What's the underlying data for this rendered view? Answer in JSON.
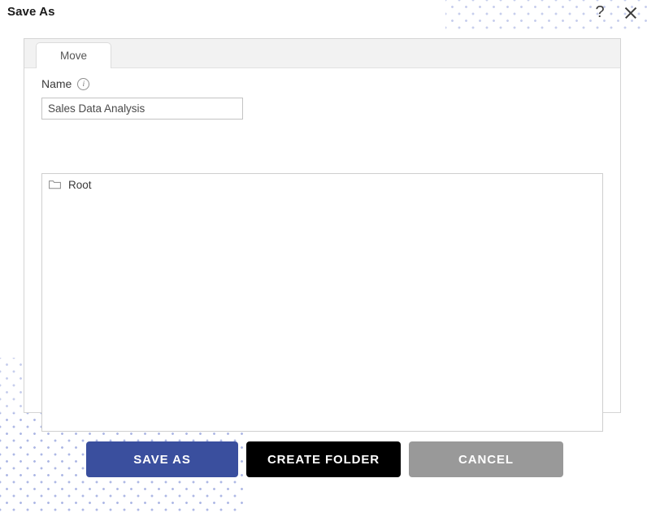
{
  "dialog": {
    "title": "Save As",
    "help_icon": "question-mark-icon",
    "close_icon": "close-icon"
  },
  "tabs": [
    {
      "label": "Move",
      "active": true
    }
  ],
  "form": {
    "name_label": "Name",
    "info_icon": "i",
    "name_value": "Sales Data Analysis",
    "name_placeholder": "Name"
  },
  "folder_tree": {
    "items": [
      {
        "label": "Root",
        "icon": "folder-icon"
      }
    ]
  },
  "buttons": {
    "save_as": "SAVE AS",
    "create_folder": "CREATE FOLDER",
    "cancel": "CANCEL"
  },
  "colors": {
    "save_as_bg": "#3a4f9e",
    "create_folder_bg": "#000000",
    "cancel_bg": "#999999",
    "dot_pattern": "#9aa7e0",
    "tab_strip_bg": "#f2f2f2",
    "panel_border": "#d4d4d4"
  }
}
